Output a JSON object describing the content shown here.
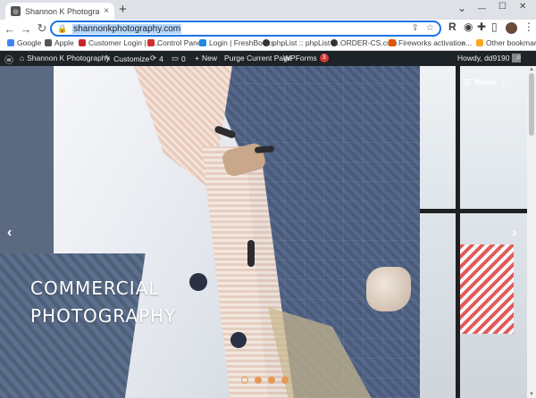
{
  "browser": {
    "tab_title": "Shannon K Photography ~ \"We c",
    "tab_close": "×",
    "new_tab": "+",
    "window_controls": {
      "chevron": "⌄",
      "minimize": "—",
      "maximize": "☐",
      "close": "✕"
    },
    "url": "shannonkphotography.com",
    "nav": {
      "back": "←",
      "forward": "→",
      "reload": "↻"
    }
  },
  "bookmarks": [
    {
      "label": "Google",
      "color": "#4285f4"
    },
    {
      "label": "Apple",
      "color": "#555555"
    },
    {
      "label": "Customer Login | In...",
      "color": "#c62828"
    },
    {
      "label": "Control Panel",
      "color": "#d32f2f"
    },
    {
      "label": "Login | FreshBooks",
      "color": "#1e88e5"
    },
    {
      "label": "phpList :: phpList :...",
      "color": "#333333"
    },
    {
      "label": "ORDER-CS.com",
      "color": "#333333"
    },
    {
      "label": "Fireworks activation...",
      "color": "#e65100"
    },
    {
      "label": "»",
      "color": ""
    },
    {
      "label": "Other bookmarks",
      "color": "#f9a825"
    }
  ],
  "adminbar": {
    "site_name": "Shannon K Photography",
    "customize": "Customize",
    "updates_count": "4",
    "comments_count": "0",
    "new_label": "New",
    "purge_label": "Purge Current Page",
    "wpforms_label": "WPForms",
    "wpforms_badge": "3",
    "howdy": "Howdy, dd9190"
  },
  "hero": {
    "heading_line1": "COMMERCIAL",
    "heading_line2": "PHOTOGRAPHY",
    "menu_label": "Menu",
    "prev_arrow": "‹",
    "next_arrow": "›",
    "slides_total": 4,
    "active_slide": 2
  },
  "colors": {
    "accent": "#1a73e8",
    "adminbar_bg": "#1d2327",
    "dot_color": "#e39a55"
  }
}
